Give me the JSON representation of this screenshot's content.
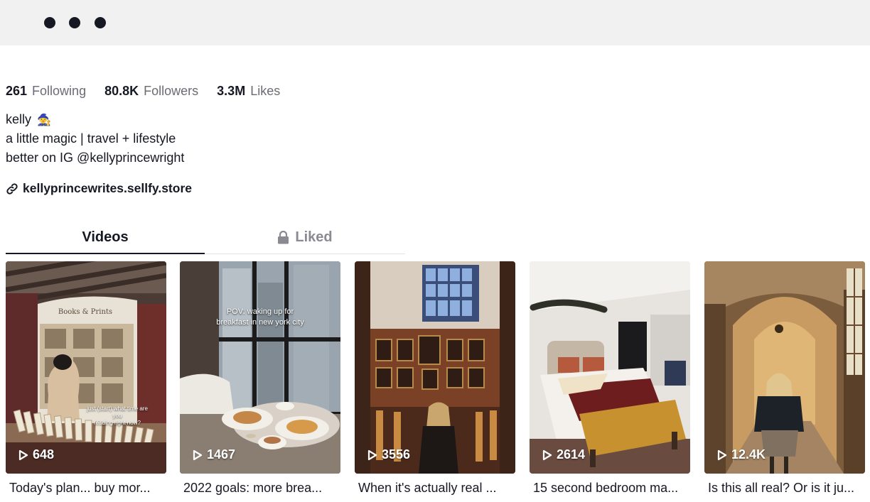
{
  "profile": {
    "stats": [
      {
        "value": "261",
        "label": "Following"
      },
      {
        "value": "80.8K",
        "label": "Followers"
      },
      {
        "value": "3.3M",
        "label": "Likes"
      }
    ],
    "name": "kelly",
    "name_emoji": "🧙",
    "bio_line1": "a little magic | travel + lifestyle",
    "bio_line2": "better on IG @kellyprincewright",
    "link": "kellyprincewrites.sellfy.store"
  },
  "tabs": {
    "videos": "Videos",
    "liked": "Liked",
    "active": "videos"
  },
  "videos": [
    {
      "views": "648",
      "caption": "Today's plan... buy mor...",
      "overlay": [
        "just (start) what time are you",
        "reading right now?"
      ]
    },
    {
      "views": "1467",
      "caption": "2022 goals: more brea...",
      "overlay": [
        "POV: waking up for",
        "breakfast in new york city"
      ]
    },
    {
      "views": "3556",
      "caption": "When it's actually real ...",
      "overlay": []
    },
    {
      "views": "2614",
      "caption": "15 second bedroom ma...",
      "overlay": []
    },
    {
      "views": "12.4K",
      "caption": "Is this all real? Or is it ju...",
      "overlay": []
    }
  ],
  "signboard": "Books & Prints",
  "colors": {
    "text_primary": "#161823",
    "text_secondary": "#6b6c73",
    "tab_inactive": "#8a8b91",
    "window_bar": "#f1f1f2"
  }
}
